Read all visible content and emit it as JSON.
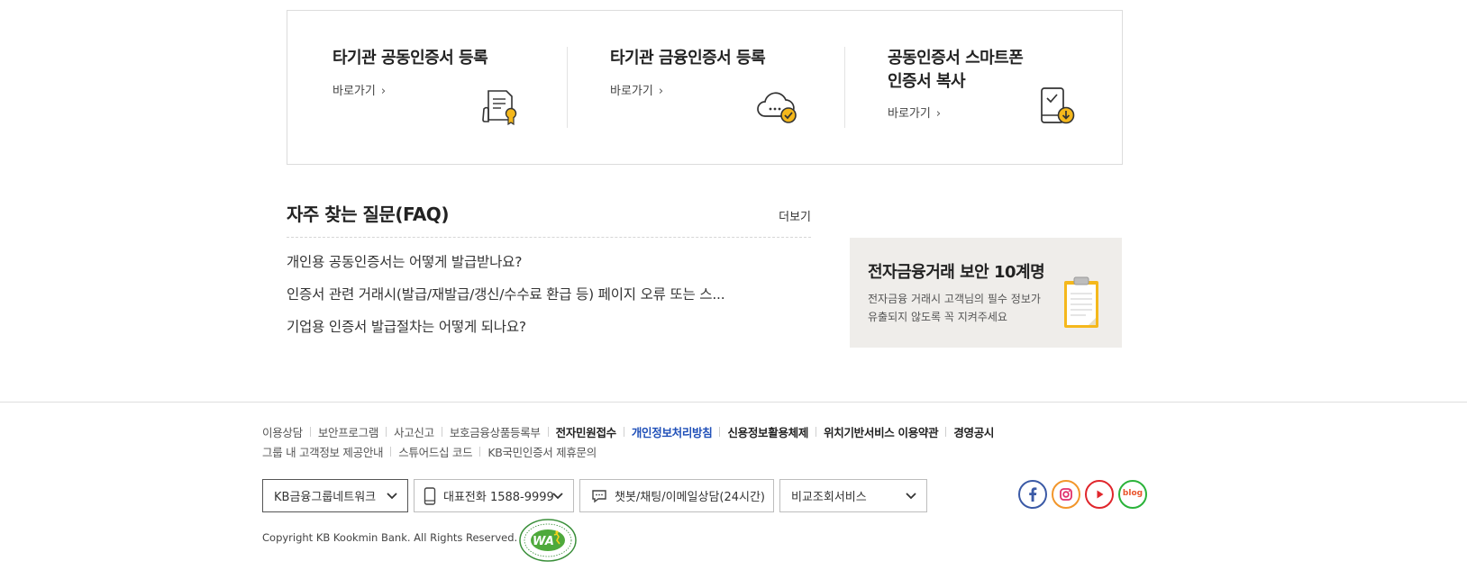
{
  "cards": [
    {
      "title": "타기관 공동인증서 등록",
      "link": "바로가기"
    },
    {
      "title": "타기관 금융인증서 등록",
      "link": "바로가기"
    },
    {
      "title_line1": "공동인증서 스마트폰",
      "title_line2": "인증서 복사",
      "link": "바로가기"
    }
  ],
  "faq": {
    "title": "자주 찾는 질문(FAQ)",
    "more": "더보기",
    "items": [
      "개인용 공동인증서는 어떻게 발급받나요?",
      "인증서 관련 거래시(발급/재발급/갱신/수수료 환급 등) 페이지 오류 또는 스...",
      "기업용 인증서 발급절차는 어떻게 되나요?"
    ]
  },
  "banner": {
    "title": "전자금융거래 보안 10계명",
    "desc_line1": "전자금융 거래시 고객님의 필수 정보가",
    "desc_line2": "유출되지 않도록 꼭 지켜주세요"
  },
  "footer": {
    "links_row1": [
      {
        "label": "이용상담",
        "style": "normal"
      },
      {
        "label": "보안프로그램",
        "style": "normal"
      },
      {
        "label": "사고신고",
        "style": "normal"
      },
      {
        "label": "보호금융상품등록부",
        "style": "normal"
      },
      {
        "label": "전자민원접수",
        "style": "bold"
      },
      {
        "label": "개인정보처리방침",
        "style": "blue"
      },
      {
        "label": "신용정보활용체제",
        "style": "bold"
      },
      {
        "label": "위치기반서비스 이용약관",
        "style": "bold"
      },
      {
        "label": "경영공시",
        "style": "bold"
      }
    ],
    "links_row2": [
      {
        "label": "그룹 내 고객정보 제공안내",
        "style": "normal"
      },
      {
        "label": "스튜어드십 코드",
        "style": "normal"
      },
      {
        "label": "KB국민인증서 제휴문의",
        "style": "normal"
      }
    ],
    "selects": {
      "group_network": "KB금융그룹네트워크",
      "phone": "대표전화 1588-9999",
      "chat": "챗봇/채팅/이메일상담(24시간)",
      "compare": "비교조회서비스"
    },
    "social": [
      "facebook-icon",
      "instagram-icon",
      "youtube-icon",
      "blog-icon"
    ],
    "blog_text": "blog",
    "copyright": "Copyright KB Kookmin Bank. All Rights Reserved.",
    "wa_text": "WA"
  },
  "colors": {
    "accent_yellow": "#f5b81c",
    "link_blue": "#1f4fb8",
    "banner_bg": "#efedea"
  }
}
